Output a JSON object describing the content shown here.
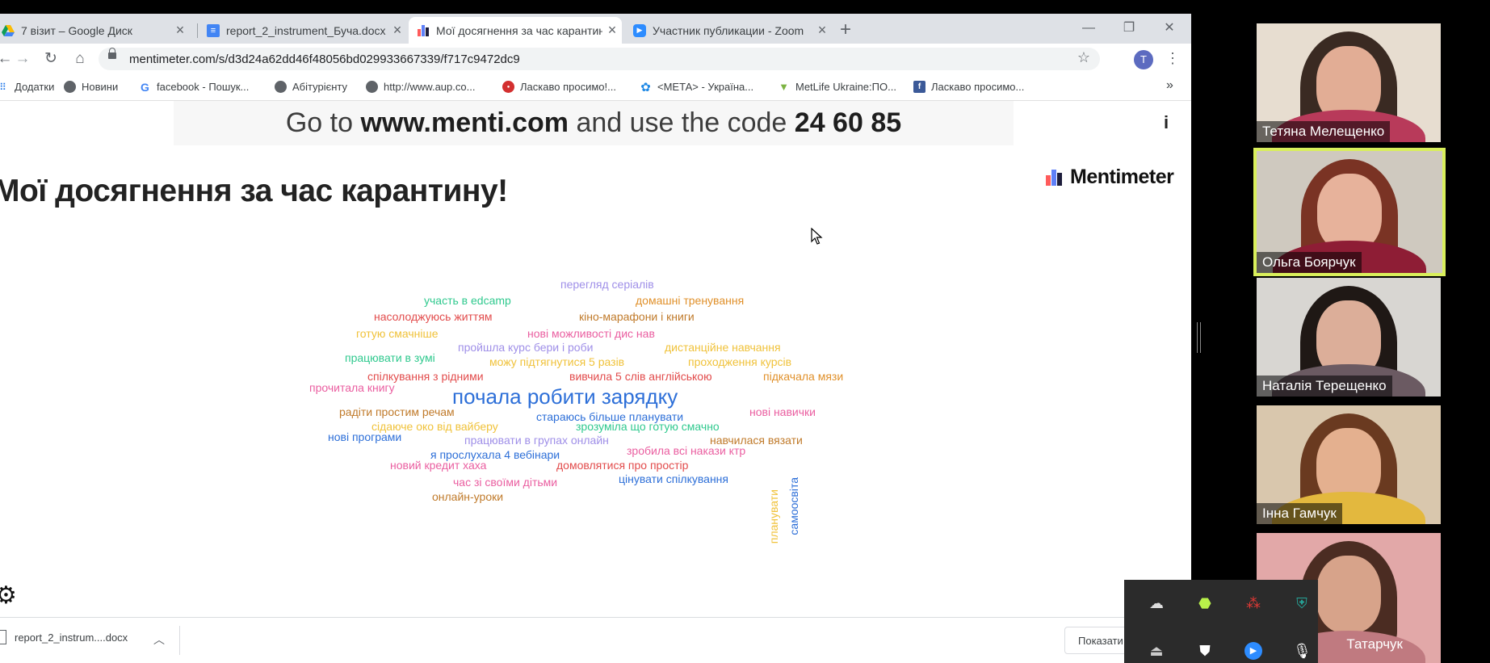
{
  "browser": {
    "tabs": [
      {
        "label": "7 візит – Google Диск",
        "icon": "google-drive-icon"
      },
      {
        "label": "report_2_instrument_Буча.docx - ",
        "icon": "google-docs-icon"
      },
      {
        "label": "Мої досягнення за час карантину",
        "icon": "mentimeter-icon"
      },
      {
        "label": "Участник публикации - Zoom",
        "icon": "zoom-icon"
      }
    ],
    "new_tab": "+",
    "url": "mentimeter.com/s/d3d24a62dd46f48056bd029933667339/f717c9472dc9",
    "avatar_letter": "T",
    "bookmarks": [
      {
        "label": "Додатки",
        "icon": "apps-grid-icon"
      },
      {
        "label": "Новини",
        "icon": "globe-icon"
      },
      {
        "label": "facebook - Пошук...",
        "icon": "google-g-icon"
      },
      {
        "label": "Абітурієнту",
        "icon": "globe-icon"
      },
      {
        "label": "http://www.aup.co...",
        "icon": "globe-icon"
      },
      {
        "label": "Ласкаво просимо!...",
        "icon": "stop-sign-icon"
      },
      {
        "label": "<МЕТА> - Україна...",
        "icon": "meta-flower-icon"
      },
      {
        "label": "MetLife Ukraine:ПО...",
        "icon": "metlife-icon"
      },
      {
        "label": "Ласкаво просимо...",
        "icon": "facebook-icon"
      }
    ],
    "more_bookmarks": "»"
  },
  "presentation": {
    "goto_prefix": "Go to ",
    "goto_site": "www.menti.com",
    "goto_mid": " and use the code ",
    "goto_code": "24 60 85",
    "info": "i",
    "question": "Мої досягнення за час карантину!",
    "brand": "Mentimeter",
    "brand_colors": [
      "#ff5b5b",
      "#5f80f8",
      "#1d1d3b"
    ]
  },
  "wordcloud": {
    "w1": "перегляд серіалів",
    "w2": "участь в edcamp",
    "w3": "домашні тренування",
    "w4": "насолоджуюсь життям",
    "w5": "кіно-марафони і книги",
    "w6": "готую смачніше",
    "w7": "нові можливості дис нав",
    "w8": "пройшла курс бери і роби",
    "w9": "дистанційне навчання",
    "w10": "працювати в зумі",
    "w11": "можу підтягнутися 5 разів",
    "w12": "проходження курсів",
    "w13": "спілкування з рідними",
    "w14": "вивчила 5 слів англійською",
    "w15": "підкачала мязи",
    "w16": "прочитала книгу",
    "w17": "почала робити зарядку",
    "w18": "радіти простим речам",
    "w19": "стараюсь більше планувати",
    "w20": "нові навички",
    "w21": "сідаюче око від вайберу",
    "w22": "зрозуміла що готую смачно",
    "w23": "нові програми",
    "w24": "працювати в групах онлайн",
    "w25": "навчилася вязати",
    "w26": "зробила всі накази ктр",
    "w27": "я прослухала 4 вебінари",
    "w28": "новий кредит хаха",
    "w29": "домовлятися про простір",
    "w30": "час зі своїми дітьми",
    "w31": "цінувати спілкування",
    "w32": "онлайн-уроки",
    "w33": "планувати",
    "w34": "самоосвіта"
  },
  "downloads": {
    "file": "report_2_instrum....docx",
    "show_all": "Показати"
  },
  "zoom": {
    "participants": [
      {
        "name": "Тетяна Мелещенко",
        "bg": "#e7ddd0",
        "hair": "#3a2a22",
        "skin": "#e2ad95",
        "shirt": "#b83a5a"
      },
      {
        "name": "Ольга Боярчук",
        "bg": "#cfc9bf",
        "hair": "#7a3324",
        "skin": "#e7b29b",
        "shirt": "#8e1d35"
      },
      {
        "name": "Наталія Терещенко",
        "bg": "#d8d6d2",
        "hair": "#1f1815",
        "skin": "#dcae99",
        "shirt": "#6b5a62"
      },
      {
        "name": "Інна Гамчук",
        "bg": "#d9c7ad",
        "hair": "#6a3a20",
        "skin": "#e4b08f",
        "shirt": "#e3b83e"
      },
      {
        "name": "Татарчук",
        "bg": "#e2a8a8",
        "hair": "#4b2c22",
        "skin": "#d7a38a",
        "shirt": "#c07a80"
      }
    ],
    "active_border": "#d9ef5b"
  },
  "tray": {
    "icons": [
      "cloud-sync-icon",
      "app-leaf-icon",
      "dots-app-icon",
      "shield-check-icon",
      "usb-icon",
      "windows-security-icon",
      "zoom-camera-icon",
      "microphone-icon"
    ]
  }
}
